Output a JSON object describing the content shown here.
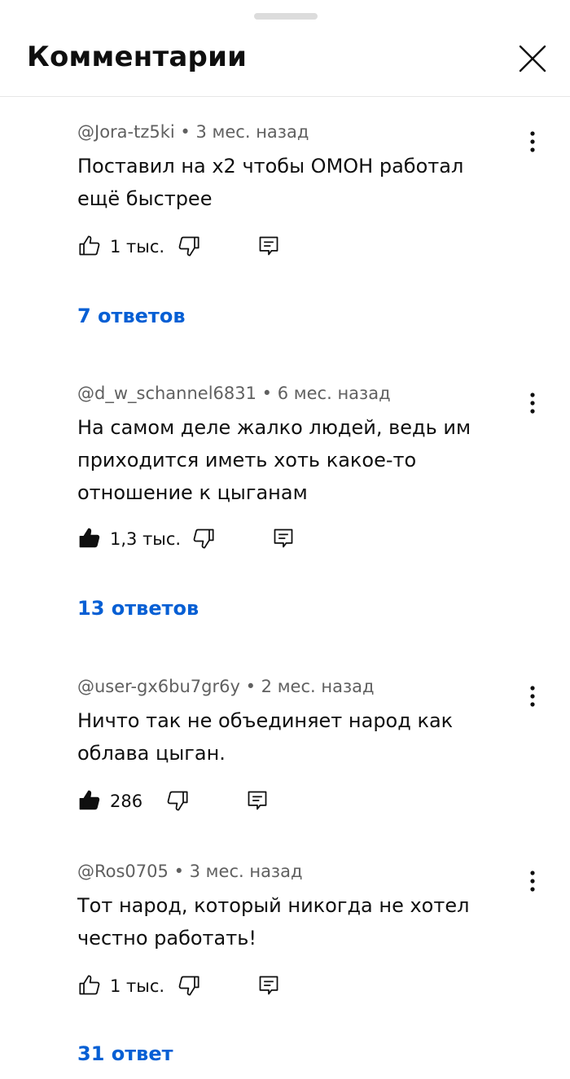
{
  "header": {
    "title": "Комментарии",
    "close_icon": "close-icon"
  },
  "comments": [
    {
      "author": "@Jora-tz5ki",
      "time": "3 мес. назад",
      "text": "Поставил на х2 чтобы ОМОН работал ещё быстрее",
      "likes": "1 тыс.",
      "liked": false,
      "replies": "7 ответов"
    },
    {
      "author": "@d_w_schannel6831",
      "time": "6 мес. назад",
      "text": "На самом деле жалко людей, ведь им приходится иметь хоть какое-то отношение к цыганам",
      "likes": "1,3 тыс.",
      "liked": true,
      "replies": "13 ответов"
    },
    {
      "author": "@user-gx6bu7gr6y",
      "time": "2 мес. назад",
      "text": "Ничто так не объединяет народ как облава цыган.",
      "likes": "286",
      "liked": true,
      "replies": ""
    },
    {
      "author": "@Ros0705",
      "time": "3 мес. назад",
      "text": "Тот народ, который никогда не хотел честно работать!",
      "likes": "1 тыс.",
      "liked": false,
      "replies": "31 ответ"
    }
  ],
  "separator": " • ",
  "icons": {
    "more": "more-vertical-icon",
    "like": "thumb-up-icon",
    "dislike": "thumb-down-icon",
    "reply": "reply-comment-icon"
  },
  "colors": {
    "link": "#065fd4",
    "meta": "#606060",
    "text": "#0f0f0f"
  }
}
